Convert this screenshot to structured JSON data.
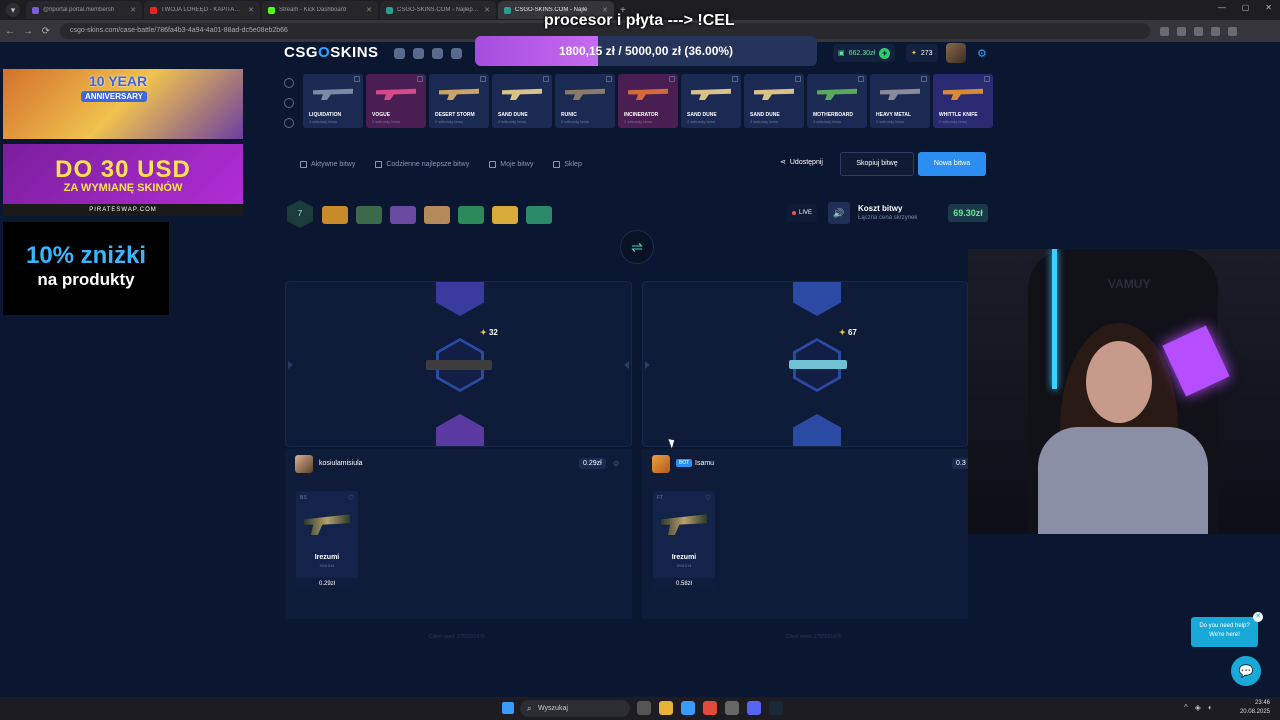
{
  "browser": {
    "tabs": [
      {
        "label": "@nportal.portal.membersh",
        "color": "#7b5bd6",
        "active": false
      },
      {
        "label": "TWOJA LOREĘD - KAPITAN NI",
        "color": "#e22",
        "active": false
      },
      {
        "label": "Stream - Kick Dashboard",
        "color": "#53fc18",
        "active": false
      },
      {
        "label": "CSGO-SKINS.COM - Najlepsze",
        "color": "#2a9d8f",
        "active": false
      },
      {
        "label": "CSGO-SKINS.COM - Najle",
        "color": "#2a9d8f",
        "active": true
      }
    ],
    "url": "csgo-skins.com/case-battle/786fa4b3-4a94-4a01-88ad-dc5e08eb2b66"
  },
  "overlay": {
    "goal_text": "1800,15 zł / 5000,00 zł (36.00%)",
    "goal_progress": 0.36,
    "stream_title": "procesor i płyta ---> !CEL"
  },
  "header": {
    "logo_a": "CSG",
    "logo_o": "O",
    "logo_b": "SKINS",
    "balance": "662.30zł",
    "coins": "273"
  },
  "live_drops": [
    {
      "name": "LIQUIDATION",
      "sub": "1 sekundy temu",
      "color": "#1b2a52",
      "gun": "#7a8aa5"
    },
    {
      "name": "VOGUE",
      "sub": "2 sekundy temu",
      "color": "#4a1e52",
      "gun": "#d44a8a"
    },
    {
      "name": "DESERT STORM",
      "sub": "2 sekundy temu",
      "color": "#1b2a52",
      "gun": "#c9a36a"
    },
    {
      "name": "SAND DUNE",
      "sub": "2 sekundy temu",
      "color": "#1b2a52",
      "gun": "#d8c28a"
    },
    {
      "name": "RUNIC",
      "sub": "2 sekundy temu",
      "color": "#1b2a52",
      "gun": "#8a7a6a"
    },
    {
      "name": "INCINERATOR",
      "sub": "2 sekundy temu",
      "color": "#4a1e52",
      "gun": "#d46a3a"
    },
    {
      "name": "SAND DUNE",
      "sub": "2 sekundy temu",
      "color": "#1b2a52",
      "gun": "#d8c28a"
    },
    {
      "name": "SAND DUNE",
      "sub": "2 sekundy temu",
      "color": "#1b2a52",
      "gun": "#d8c28a"
    },
    {
      "name": "MOTHERBOARD",
      "sub": "2 sekundy temu",
      "color": "#1b2a52",
      "gun": "#5aa85a"
    },
    {
      "name": "HEAVY METAL",
      "sub": "2 sekundy temu",
      "color": "#1b2a52",
      "gun": "#8a8a9a"
    },
    {
      "name": "WHITTLE KNIFE",
      "sub": "2 sekundy temu",
      "color": "#2a2a72",
      "gun": "#d88a3a"
    }
  ],
  "nav": {
    "active_battles": "Aktywne bitwy",
    "daily_best": "Codzienne najlepsze bitwy",
    "my_battles": "Moje bitwy",
    "shop": "Sklep",
    "share": "Udostępnij",
    "copy_battle": "Skopiuj bitwę",
    "new_battle": "Nowa bitwa"
  },
  "battle": {
    "rounds": "7",
    "live": "LIVE",
    "cost_title": "Koszt bitwy",
    "cost_subtitle": "Łączna cena skrzynek",
    "cost_value": "69.30zł",
    "cases": [
      "#c98a2a",
      "#3a6a4a",
      "#6a4aa0",
      "#b58a5a",
      "#2a8a5a",
      "#d8aa3a",
      "#2a8a6a"
    ]
  },
  "spinners": [
    {
      "value": "32"
    },
    {
      "value": "67"
    }
  ],
  "players": [
    {
      "name": "kosiulamisiula",
      "total": "0.29zł",
      "bot": false,
      "item": {
        "tag": "BS",
        "name": "Irezumi",
        "sub": "XM1014",
        "price": "0.29zł"
      },
      "seed": "Client seed: 1755551476"
    },
    {
      "name": "Isamu",
      "total": "0.3",
      "bot": true,
      "bot_label": "BOT",
      "item": {
        "tag": "FT",
        "name": "Irezumi",
        "sub": "XM1014",
        "price": "0.58zł"
      },
      "seed": "Client seed: 1755551476"
    }
  ],
  "ads": {
    "anniv_big": "10 YEAR",
    "anniv_small": "ANNIVERSARY",
    "swap_big": "DO 30 USD",
    "swap_mid": "ZA WYMIANĘ SKINÓW",
    "swap_foot": "PIRATESWAP.COM",
    "discount_big": "10% zniżki",
    "discount_small": "na produkty"
  },
  "webcam": {
    "logo": "VAMUY"
  },
  "help": {
    "line1": "Do you need help?",
    "line2": "We're here!"
  },
  "taskbar": {
    "search": "Wyszukaj",
    "time": "23:46",
    "date": "20.08.2025"
  },
  "icons": {
    "back": "←",
    "forward": "→",
    "reload": "⟳",
    "sound": "🔊",
    "vs": "⇌",
    "heart": "♡",
    "chat": "💬",
    "close": "✕",
    "settings": "⚙",
    "search": "⌕",
    "plus": "+"
  }
}
